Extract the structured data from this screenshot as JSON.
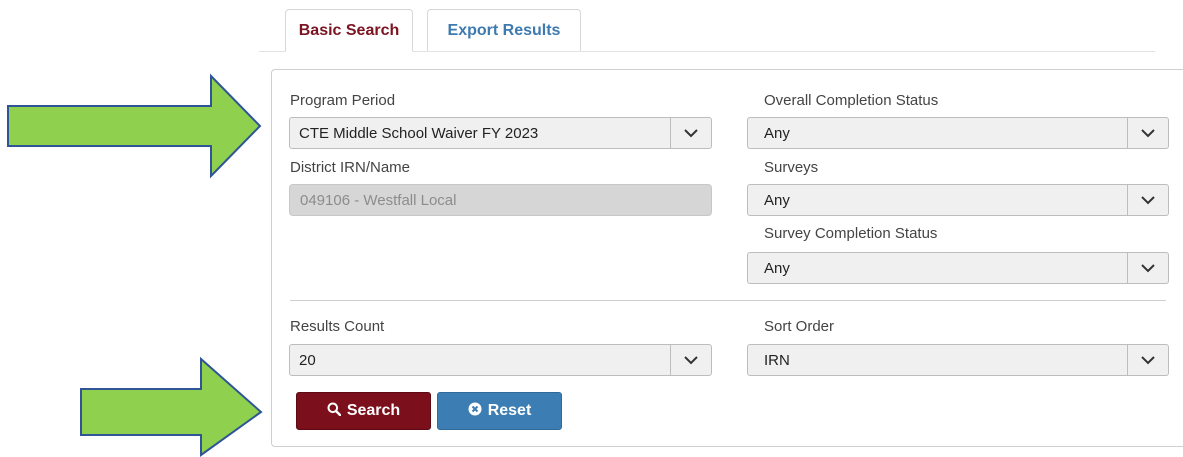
{
  "tabs": {
    "basic_search": "Basic Search",
    "export_results": "Export Results"
  },
  "filters": {
    "program_period": {
      "label": "Program Period",
      "value": "CTE Middle School Waiver FY 2023"
    },
    "district": {
      "label": "District IRN/Name",
      "value": "049106 - Westfall Local"
    },
    "overall_completion_status": {
      "label": "Overall Completion Status",
      "value": "Any"
    },
    "surveys": {
      "label": "Surveys",
      "value": "Any"
    },
    "survey_completion_status": {
      "label": "Survey Completion Status",
      "value": "Any"
    },
    "results_count": {
      "label": "Results Count",
      "value": "20"
    },
    "sort_order": {
      "label": "Sort Order",
      "value": "IRN"
    }
  },
  "actions": {
    "search_label": "Search",
    "reset_label": "Reset"
  },
  "colors": {
    "active_tab_text": "#7a1422",
    "inactive_tab_text": "#3d7ab0",
    "search_button": "#7b0f1b",
    "reset_button": "#3c7eb4",
    "annotation_arrow_fill": "#8fd14f",
    "annotation_arrow_stroke": "#2f5597"
  },
  "icons": {
    "dropdown": "chevron-down-icon",
    "search": "search-icon",
    "reset": "times-circle-icon",
    "annotation": "arrow-right-icon"
  }
}
